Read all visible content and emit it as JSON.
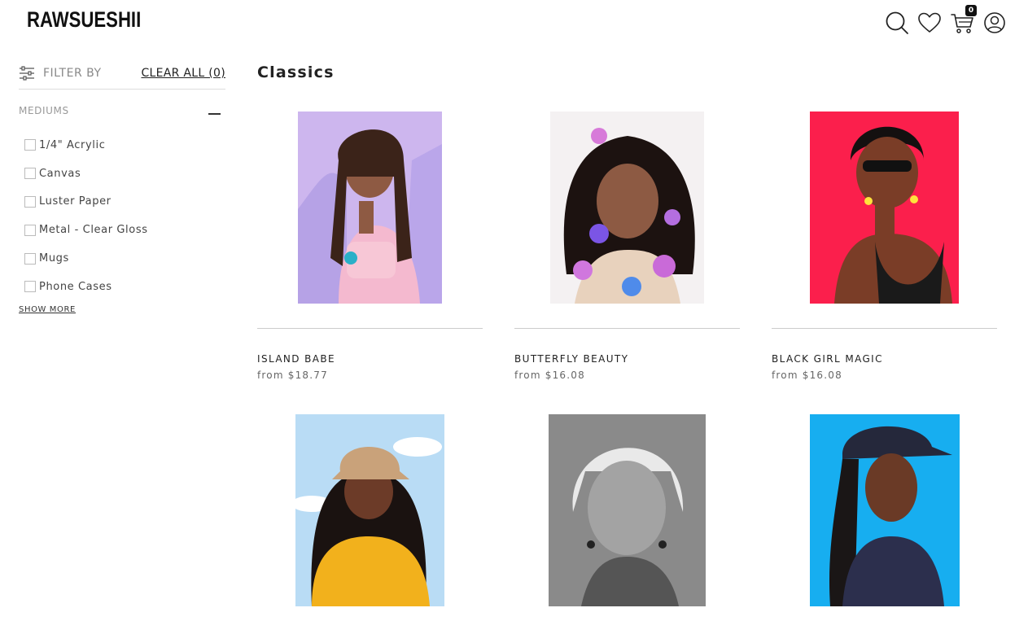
{
  "header": {
    "logo": "RAWSUESHII",
    "cart_count": "0",
    "icons": [
      "search-icon",
      "heart-icon",
      "cart-icon",
      "account-icon"
    ]
  },
  "sidebar": {
    "filter_by": "FILTER BY",
    "clear_all": "CLEAR ALL (0)",
    "mediums_title": "MEDIUMS",
    "mediums": [
      {
        "label": "1/4\" Acrylic",
        "checked": false
      },
      {
        "label": "Canvas",
        "checked": false
      },
      {
        "label": "Luster Paper",
        "checked": false
      },
      {
        "label": "Metal - Clear Gloss",
        "checked": false
      },
      {
        "label": "Mugs",
        "checked": false
      },
      {
        "label": "Phone Cases",
        "checked": false
      }
    ],
    "show_more": "SHOW MORE"
  },
  "main": {
    "title": "Classics",
    "products": [
      {
        "name": "ISLAND BABE",
        "price": "from $18.77",
        "bg": "#cdb6ee"
      },
      {
        "name": "BUTTERFLY BEAUTY",
        "price": "from $16.08",
        "bg": "#f4f1f2"
      },
      {
        "name": "BLACK GIRL MAGIC",
        "price": "from $16.08",
        "bg": "#fb1f4c"
      },
      {
        "name": "",
        "price": "",
        "bg": "#b9dcf5"
      },
      {
        "name": "",
        "price": "",
        "bg": "#8a8a8a"
      },
      {
        "name": "",
        "price": "",
        "bg": "#17aef0"
      }
    ]
  }
}
